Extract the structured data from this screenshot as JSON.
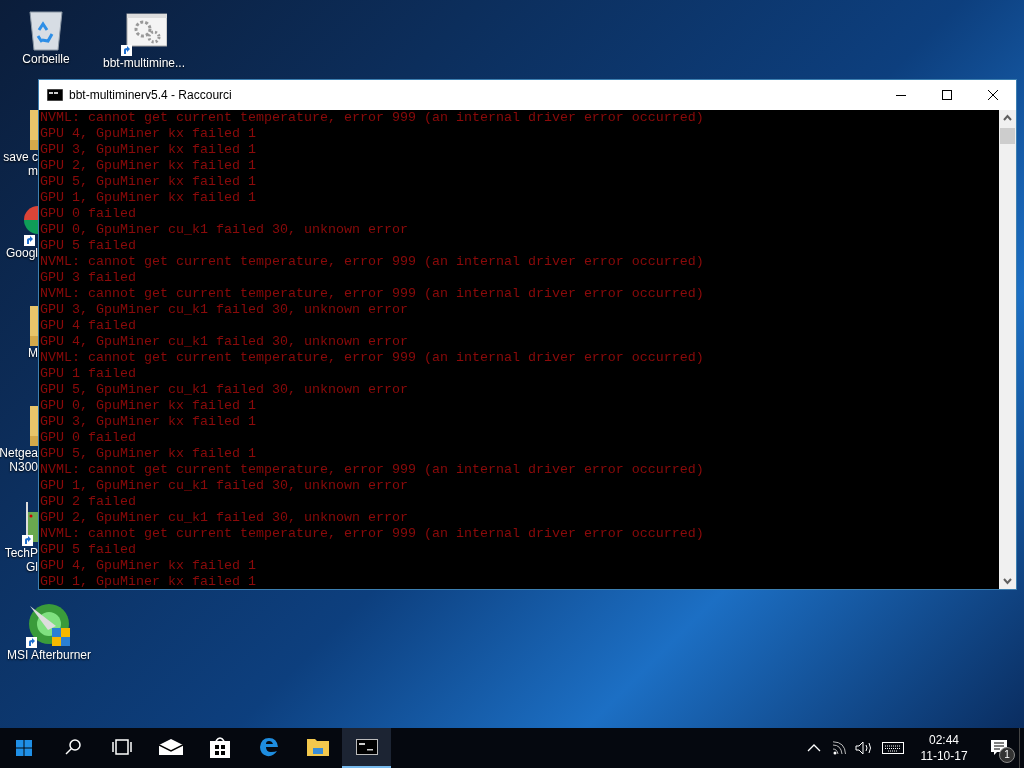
{
  "desktop_icons": [
    {
      "kind": "recycle",
      "label": [
        "Corbeille"
      ]
    },
    {
      "kind": "shortcut",
      "label": [
        "bbt-multimine..."
      ]
    },
    {
      "kind": "folder",
      "label": [
        "save c",
        "m"
      ]
    },
    {
      "kind": "chrome",
      "label": [
        "Googl"
      ]
    },
    {
      "kind": "folder",
      "label": [
        "M"
      ]
    },
    {
      "kind": "folder",
      "label": [
        "Netgea",
        "N300"
      ]
    },
    {
      "kind": "card",
      "label": [
        "TechP",
        "Gl"
      ]
    },
    {
      "kind": "afterburner",
      "label": [
        "MSI Afterburner"
      ]
    }
  ],
  "window": {
    "title": "bbt-multiminerv5.4 - Raccourci",
    "console_lines": [
      "NVML: cannot get current temperature, error 999 (an internal driver error occurred)",
      "GPU 4, GpuMiner kx failed 1",
      "GPU 3, GpuMiner kx failed 1",
      "GPU 2, GpuMiner kx failed 1",
      "GPU 5, GpuMiner kx failed 1",
      "GPU 1, GpuMiner kx failed 1",
      "GPU 0 failed",
      "GPU 0, GpuMiner cu_k1 failed 30, unknown error",
      "GPU 5 failed",
      "NVML: cannot get current temperature, error 999 (an internal driver error occurred)",
      "GPU 3 failed",
      "NVML: cannot get current temperature, error 999 (an internal driver error occurred)",
      "GPU 3, GpuMiner cu_k1 failed 30, unknown error",
      "GPU 4 failed",
      "GPU 4, GpuMiner cu_k1 failed 30, unknown error",
      "NVML: cannot get current temperature, error 999 (an internal driver error occurred)",
      "GPU 1 failed",
      "GPU 5, GpuMiner cu_k1 failed 30, unknown error",
      "GPU 0, GpuMiner kx failed 1",
      "GPU 3, GpuMiner kx failed 1",
      "GPU 0 failed",
      "GPU 5, GpuMiner kx failed 1",
      "NVML: cannot get current temperature, error 999 (an internal driver error occurred)",
      "GPU 1, GpuMiner cu_k1 failed 30, unknown error",
      "GPU 2 failed",
      "GPU 2, GpuMiner cu_k1 failed 30, unknown error",
      "NVML: cannot get current temperature, error 999 (an internal driver error occurred)",
      "GPU 5 failed",
      "GPU 4, GpuMiner kx failed 1",
      "GPU 1, GpuMiner kx failed 1"
    ]
  },
  "taskbar": {
    "apps": [
      {
        "kind": "search",
        "selected": false
      },
      {
        "kind": "taskview",
        "selected": false
      },
      {
        "kind": "mail",
        "selected": false
      },
      {
        "kind": "store",
        "selected": false
      },
      {
        "kind": "edge",
        "selected": false
      },
      {
        "kind": "explorer",
        "selected": false
      },
      {
        "kind": "console",
        "selected": true
      }
    ],
    "time": "02:44",
    "date": "11-10-17",
    "notification_count": "1"
  }
}
